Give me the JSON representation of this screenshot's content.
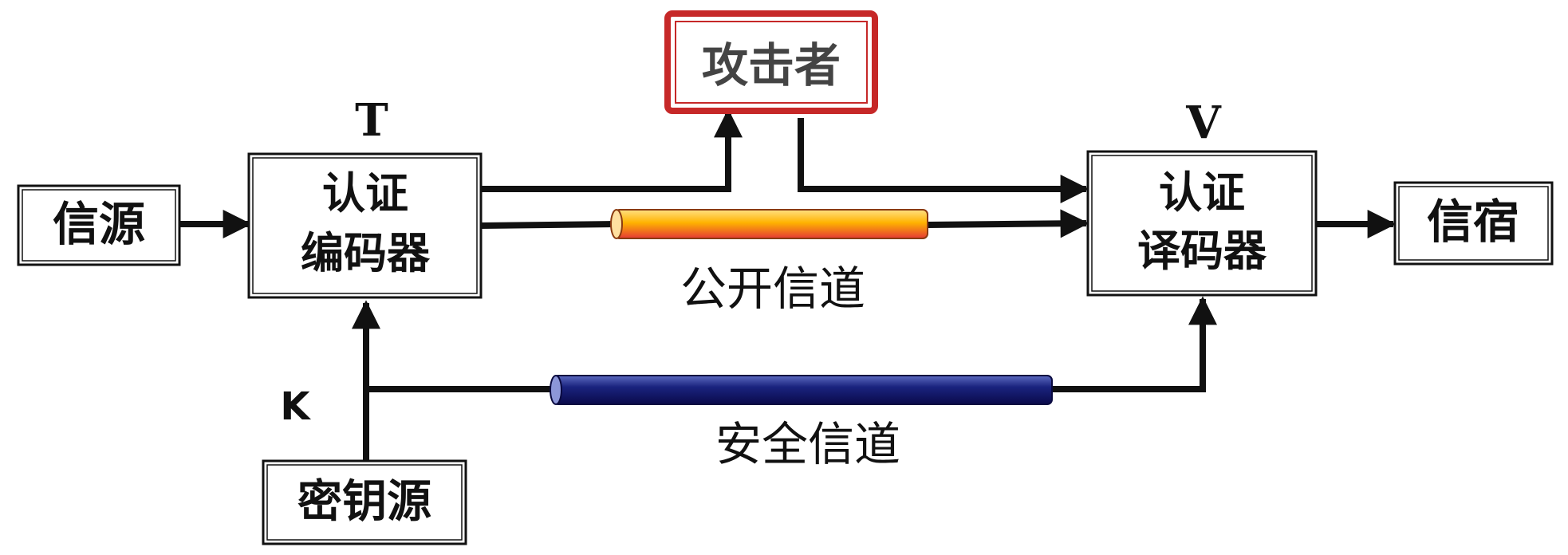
{
  "nodes": {
    "source": {
      "label": "信源"
    },
    "encoder": {
      "line1": "认证",
      "line2": "编码器"
    },
    "attacker": {
      "label": "攻击者"
    },
    "decoder": {
      "line1": "认证",
      "line2": "译码器"
    },
    "sink": {
      "label": "信宿"
    },
    "key_source": {
      "label": "密钥源"
    }
  },
  "variables": {
    "t": "T",
    "v": "V",
    "k": "K"
  },
  "channels": {
    "public": {
      "label": "公开信道"
    },
    "secure": {
      "label": "安全信道"
    }
  },
  "colors": {
    "attacker_border": "#c62828",
    "public_channel_top": "#ffd54f",
    "public_channel_bottom": "#e53935",
    "secure_channel_top": "#3949ab",
    "secure_channel_bottom": "#0d0d6b",
    "stroke": "#111111"
  }
}
